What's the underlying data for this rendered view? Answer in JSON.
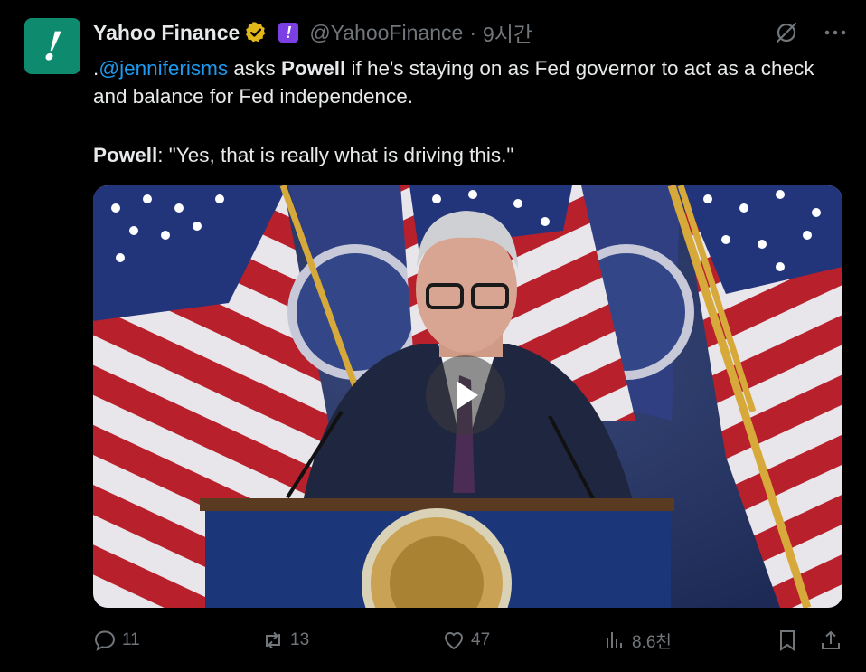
{
  "tweet": {
    "author_name": "Yahoo Finance",
    "handle": "@YahooFinance",
    "separator": "·",
    "time": "9시간",
    "avatar_glyph": "!",
    "affiliate_glyph": "!",
    "text_prefix": ".",
    "mention": "@jenniferisms",
    "text_asks": " asks ",
    "bold_name": "Powell",
    "text_rest": " if he's staying on as Fed governor to act as a check and balance for Fed independence.",
    "quote_name": "Powell",
    "quote_text": ": \"Yes, that is really what is driving this.\""
  },
  "actions": {
    "replies": "11",
    "reposts": "13",
    "likes": "47",
    "views": "8.6천"
  },
  "colors": {
    "background": "#000000",
    "text": "#e7e9ea",
    "muted": "#71767b",
    "link": "#1d9bf0",
    "avatar": "#0e8a6e",
    "verified": "#e2b719",
    "affiliate": "#7b3fe4"
  },
  "icons": [
    "verified-badge-icon",
    "affiliate-badge-icon",
    "grok-icon",
    "more-icon",
    "play-icon",
    "reply-icon",
    "repost-icon",
    "like-icon",
    "views-icon",
    "bookmark-icon",
    "share-icon"
  ]
}
